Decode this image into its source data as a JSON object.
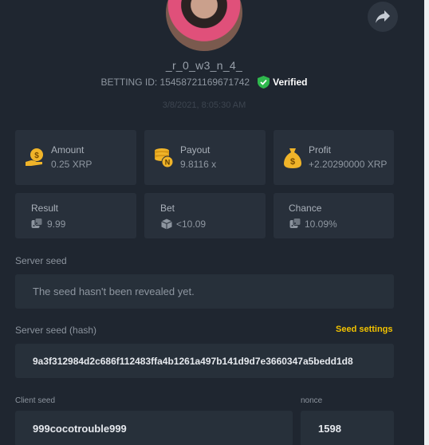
{
  "profile": {
    "username": "_r_0_w3_n_4_",
    "betting_id": "BETTING ID: 15458721169671742",
    "verified_label": "Verified",
    "timestamp": "3/8/2021, 8:05:30 AM"
  },
  "stats": {
    "amount": {
      "label": "Amount",
      "value": "0.25 XRP",
      "icon": "money-bag-coin-icon"
    },
    "payout": {
      "label": "Payout",
      "value": "9.8116 x",
      "icon": "coin-stack-icon"
    },
    "profit": {
      "label": "Profit",
      "value": "+2.20290000 XRP",
      "icon": "dollar-bag-icon"
    },
    "result": {
      "label": "Result",
      "value": "9.99",
      "icon": "dice-icon"
    },
    "bet": {
      "label": "Bet",
      "value": "<10.09",
      "icon": "cube-icon"
    },
    "chance": {
      "label": "Chance",
      "value": "10.09%",
      "icon": "dice-icon"
    }
  },
  "server_seed": {
    "label": "Server seed",
    "value": "The seed hasn't been revealed yet."
  },
  "server_seed_hash": {
    "label": "Server seed (hash)",
    "value": "9a3f312984d2c686f112483ffa4b1261a497b141d9d7e3660347a5bedd1d8",
    "settings_label": "Seed settings"
  },
  "client_seed": {
    "label": "Client seed",
    "value": "999cocotrouble999"
  },
  "nonce": {
    "label": "nonce",
    "value": "1598"
  },
  "colors": {
    "background": "#1f2630",
    "card": "#28303b",
    "accent_yellow": "#f2c200",
    "verified_green": "#2fb84d"
  }
}
